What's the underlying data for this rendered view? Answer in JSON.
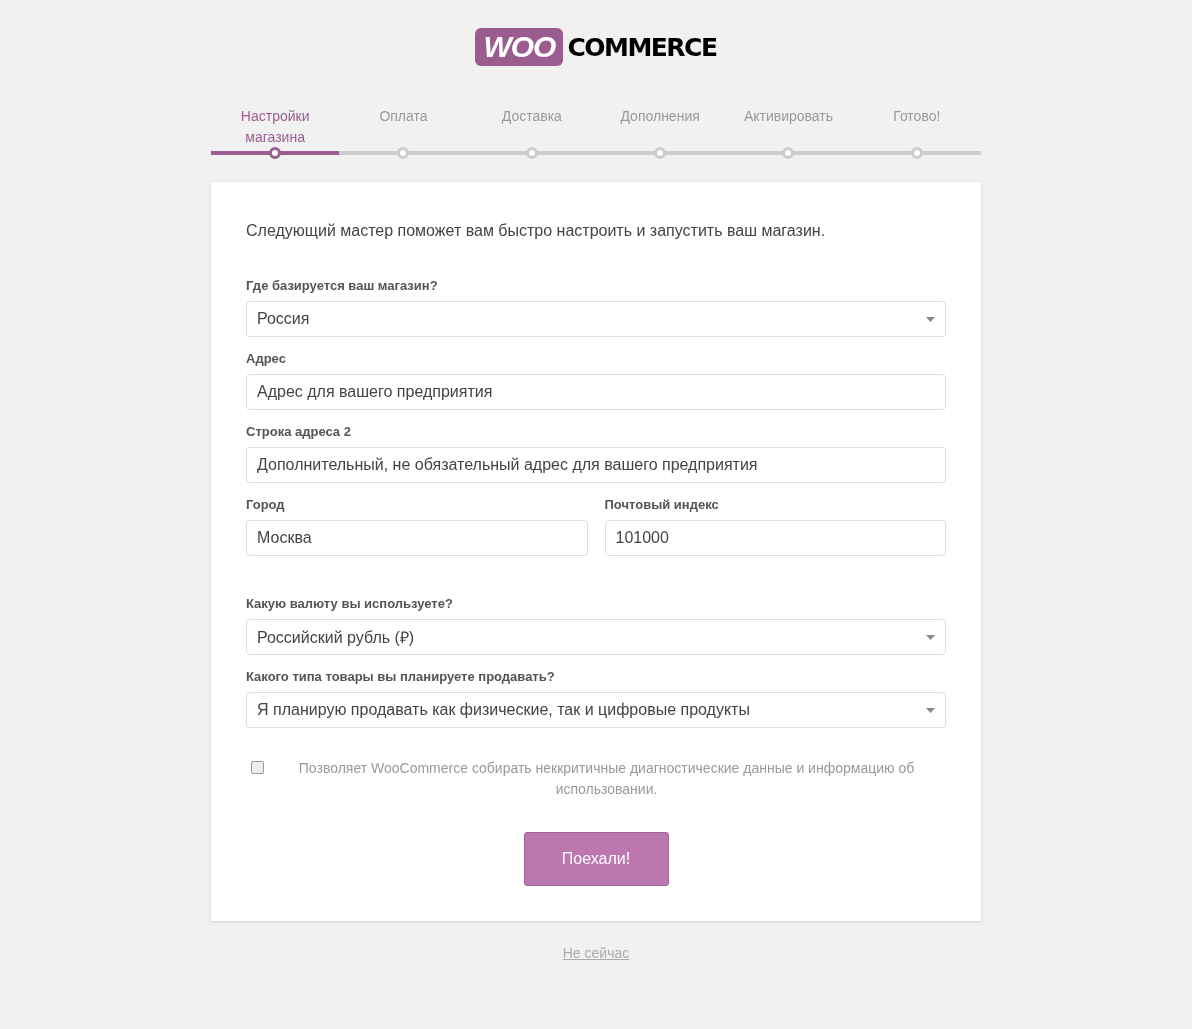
{
  "logo": {
    "badge": "WOO",
    "text": "COMMERCE"
  },
  "steps": [
    {
      "label": "Настройки магазина",
      "selected": true
    },
    {
      "label": "Оплата",
      "selected": false
    },
    {
      "label": "Доставка",
      "selected": false
    },
    {
      "label": "Дополнения",
      "selected": false
    },
    {
      "label": "Активировать",
      "selected": false
    },
    {
      "label": "Готово!",
      "selected": false
    }
  ],
  "intro": "Следующий мастер поможет вам быстро настроить и запустить ваш магазин.",
  "address_section": [
    [
      {
        "label": "Где базируется ваш магазин?",
        "kind": "select",
        "value": "Россия"
      }
    ],
    [
      {
        "label": "Адрес",
        "kind": "text",
        "placeholder": "Адрес для вашего предприятия"
      }
    ],
    [
      {
        "label": "Строка адреса 2",
        "kind": "text",
        "placeholder": "Дополнительный, не обязательный адрес для вашего предприятия"
      }
    ],
    [
      {
        "label": "Город",
        "kind": "text",
        "value": "Москва"
      },
      {
        "label": "Почтовый индекс",
        "kind": "text",
        "value": "101000"
      }
    ]
  ],
  "business_section": [
    [
      {
        "label": "Какую валюту вы используете?",
        "kind": "select",
        "value": "Российский рубль (₽)"
      }
    ],
    [
      {
        "label": "Какого типа товары вы планируете продавать?",
        "kind": "select",
        "value": "Я планирую продавать как физические, так и цифровые продукты"
      }
    ]
  ],
  "tracking": {
    "checked": false,
    "text": "Позволяет WooCommerce собирать неккритичные диагностические данные и информацию об использовании."
  },
  "submit": "Поехали!",
  "skip_link": "Не сейчас"
}
